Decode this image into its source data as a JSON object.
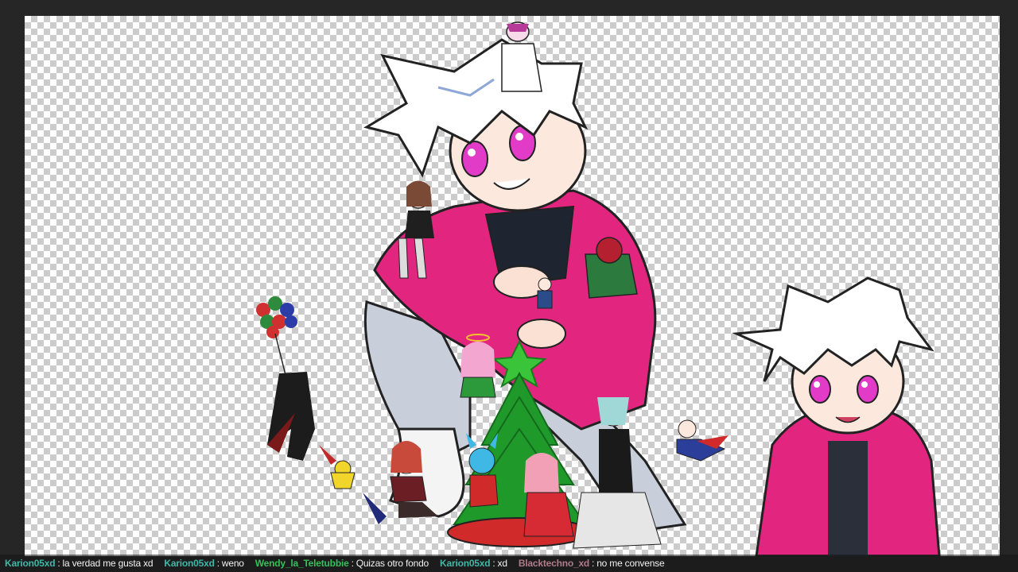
{
  "stream": {
    "overlay_art": {
      "main_character": "white-haired-pink-hoodie-character",
      "vtuber_avatar": "white-haired-avatar",
      "decorations": [
        "christmas-tree",
        "balloons",
        "chibi-figures"
      ]
    }
  },
  "chat": {
    "separator": ":",
    "messages": [
      {
        "user": "Karion05xd",
        "text": "la verdad me gusta xd",
        "color": "#3fb8a8"
      },
      {
        "user": "Karion05xd",
        "text": "weno",
        "color": "#3fb8a8"
      },
      {
        "user": "Wendy_la_Teletubbie",
        "text": "Quizas otro fondo",
        "color": "#34c05a"
      },
      {
        "user": "Karion05xd",
        "text": "xd",
        "color": "#3fb8a8"
      },
      {
        "user": "Blacktechno_xd",
        "text": "no me convense",
        "color": "#b07c8c"
      }
    ]
  }
}
